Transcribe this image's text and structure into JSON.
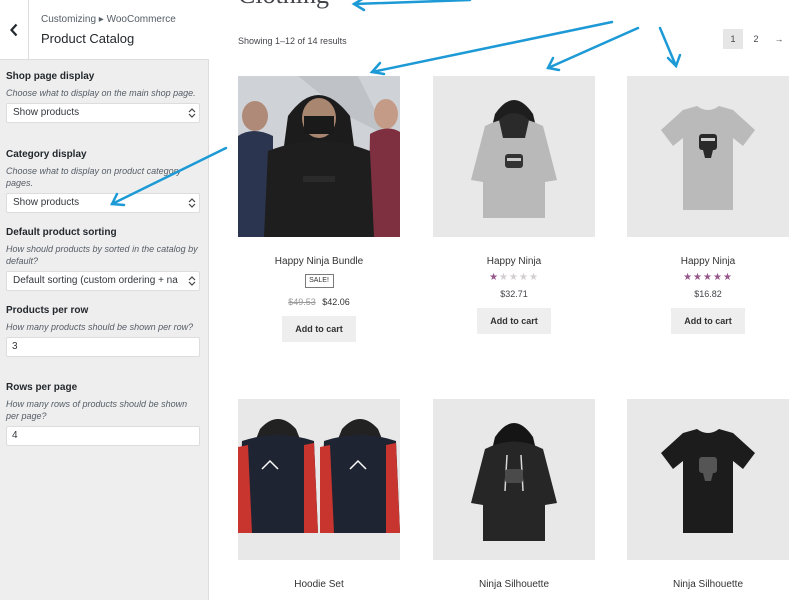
{
  "customizer": {
    "breadcrumb": "Customizing ▸ WooCommerce",
    "section_title": "Product Catalog",
    "groups": [
      {
        "title": "Shop page display",
        "description": "Choose what to display on the main shop page.",
        "value": "Show products"
      },
      {
        "title": "Category display",
        "description": "Choose what to display on product category pages.",
        "value": "Show products"
      },
      {
        "title": "Default product sorting",
        "description": "How should products by sorted in the catalog by default?",
        "value": "Default sorting (custom ordering + na"
      },
      {
        "title": "Products per row",
        "description": "How many products should be shown per row?",
        "value": "3"
      },
      {
        "title": "Rows per page",
        "description": "How many rows of products should be shown per page?",
        "value": "4"
      }
    ]
  },
  "shop": {
    "heading": "Clothing",
    "result_count": "Showing 1–12 of 14 results",
    "pagination": [
      "1",
      "2",
      "→"
    ],
    "products": [
      {
        "name": "Happy Ninja Bundle",
        "badge": "SALE!",
        "old_price": "$49.53",
        "price": "$42.06",
        "rating": 0,
        "button": "Add to cart"
      },
      {
        "name": "Happy Ninja",
        "price": "$32.71",
        "rating": 1,
        "button": "Add to cart"
      },
      {
        "name": "Happy Ninja",
        "price": "$16.82",
        "rating": 5,
        "button": "Add to cart"
      },
      {
        "name": "Hoodie Set"
      },
      {
        "name": "Ninja Silhouette"
      },
      {
        "name": "Ninja Silhouette"
      }
    ]
  },
  "colors": {
    "accent_arrow": "#1d9ad6",
    "star": "#96588a"
  }
}
